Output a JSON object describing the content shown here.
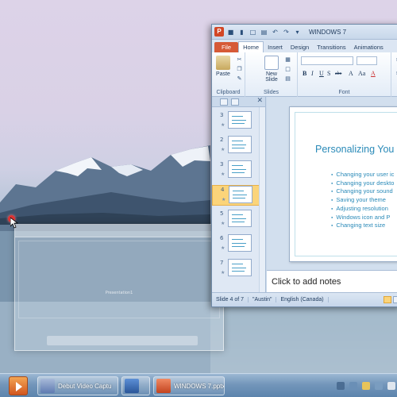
{
  "ghost_window": {
    "caption": "Presentation1"
  },
  "powerpoint": {
    "window_title": "WINDOWS 7",
    "tabs": [
      "File",
      "Home",
      "Insert",
      "Design",
      "Transitions",
      "Animations"
    ],
    "ribbon": {
      "paste_label": "Paste",
      "new_slide_label": "New Slide",
      "groups": {
        "clipboard": "Clipboard",
        "slides": "Slides",
        "font": "Font"
      },
      "font_buttons": [
        "B",
        "I",
        "U",
        "S",
        "abc",
        "A",
        "Aa",
        "A"
      ]
    },
    "thumbnails": [
      {
        "num": "3",
        "selected": false
      },
      {
        "num": "2",
        "selected": false
      },
      {
        "num": "3",
        "selected": false
      },
      {
        "num": "4",
        "selected": true
      },
      {
        "num": "5",
        "selected": false
      },
      {
        "num": "6",
        "selected": false
      },
      {
        "num": "7",
        "selected": false
      }
    ],
    "slide": {
      "title": "Personalizing You",
      "bullets": [
        "Changing your user ic",
        "Changing your deskto",
        "Changing your sound",
        "Saving your theme",
        "Adjusting resolution",
        "Windows icon and P",
        "Changing text size"
      ]
    },
    "notes_placeholder": "Click to add notes",
    "status": {
      "slide_counter": "Slide 4 of 7",
      "theme": "\"Austin\"",
      "language": "English (Canada)"
    }
  },
  "taskbar": {
    "items": [
      {
        "label": "Debut Video Captu",
        "icon": "debut-icon"
      },
      {
        "label": "",
        "icon": "word-icon"
      },
      {
        "label": "WINDOWS 7.pptx",
        "icon": "powerpoint-icon"
      }
    ]
  },
  "colors": {
    "accent_title": "#2a8ab8",
    "powerpoint_orange": "#d24726",
    "selection": "#fbd47a"
  }
}
